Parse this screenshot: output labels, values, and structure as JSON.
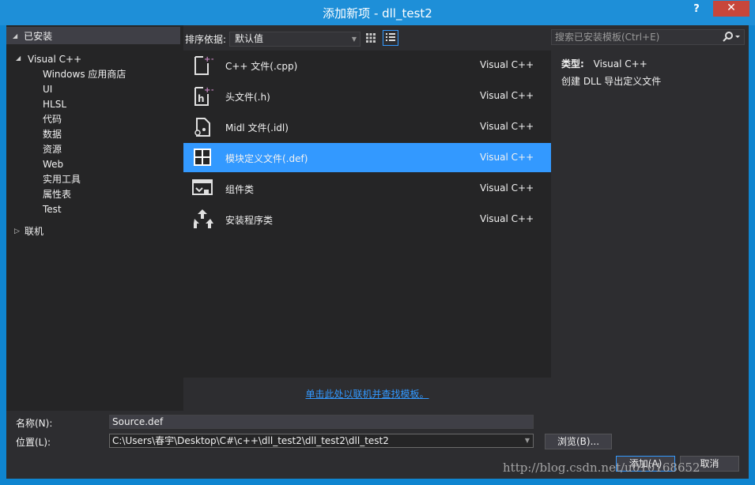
{
  "window": {
    "title": "添加新项 - dll_test2",
    "help": "?",
    "close": "✕"
  },
  "left": {
    "installed": "已安装",
    "tree": [
      {
        "label": "Visual C++",
        "indent": 0,
        "expanded": true
      },
      {
        "label": "Windows 应用商店",
        "indent": 1
      },
      {
        "label": "UI",
        "indent": 1
      },
      {
        "label": "HLSL",
        "indent": 1
      },
      {
        "label": "代码",
        "indent": 1,
        "selected": true
      },
      {
        "label": "数据",
        "indent": 1
      },
      {
        "label": "资源",
        "indent": 1
      },
      {
        "label": "Web",
        "indent": 1
      },
      {
        "label": "实用工具",
        "indent": 1
      },
      {
        "label": "属性表",
        "indent": 1
      },
      {
        "label": "Test",
        "indent": 1
      }
    ],
    "online": "联机"
  },
  "toolbar": {
    "sort_label": "排序依据:",
    "sort_value": "默认值"
  },
  "templates": [
    {
      "name": "C++ 文件(.cpp)",
      "lang": "Visual C++",
      "icon": "cpp-file-icon"
    },
    {
      "name": "头文件(.h)",
      "lang": "Visual C++",
      "icon": "header-file-icon"
    },
    {
      "name": "Midl 文件(.idl)",
      "lang": "Visual C++",
      "icon": "midl-file-icon"
    },
    {
      "name": "模块定义文件(.def)",
      "lang": "Visual C++",
      "icon": "def-file-icon",
      "selected": true
    },
    {
      "name": "组件类",
      "lang": "Visual C++",
      "icon": "component-class-icon"
    },
    {
      "name": "安装程序类",
      "lang": "Visual C++",
      "icon": "installer-class-icon"
    }
  ],
  "online_link": "单击此处以联机并查找模板。",
  "search": {
    "placeholder": "搜索已安装模板(Ctrl+E)"
  },
  "details": {
    "type_label": "类型:",
    "type_value": "Visual C++",
    "description": "创建 DLL 导出定义文件"
  },
  "bottom": {
    "name_label": "名称(N):",
    "name_value": "Source.def",
    "location_label": "位置(L):",
    "location_value": "C:\\Users\\春宇\\Desktop\\C#\\c++\\dll_test2\\dll_test2\\dll_test2",
    "browse": "浏览(B)...",
    "add": "添加(A)",
    "cancel": "取消"
  },
  "watermark": "http://blog.csdn.net/u010168652",
  "colors": {
    "accent": "#3399ff",
    "titlebar": "#1e8fd8",
    "close": "#c7463b",
    "background": "#2d2d30",
    "panel": "#252526"
  }
}
